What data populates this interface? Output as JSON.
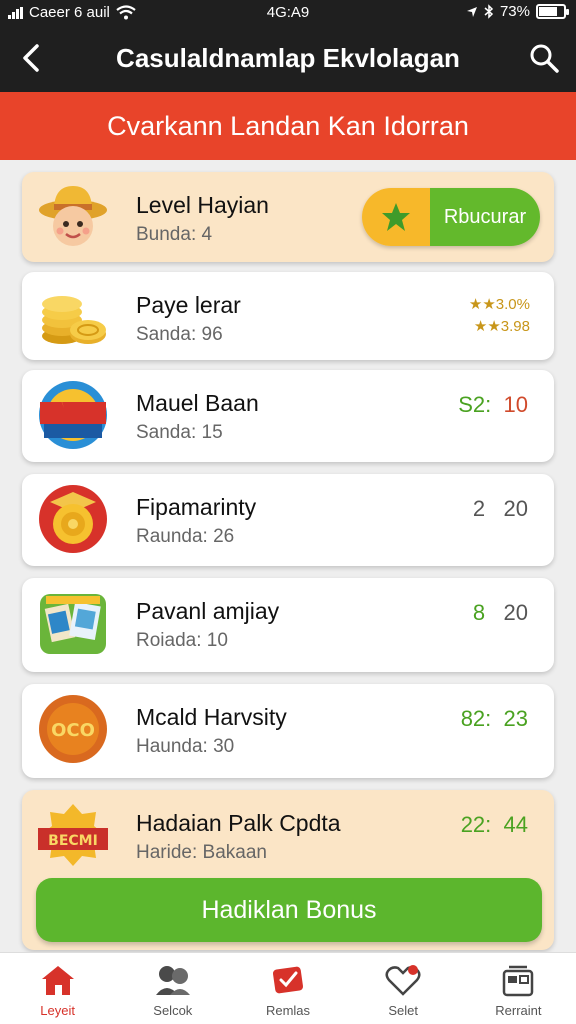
{
  "status_bar": {
    "carrier": "Caeer 6 auil",
    "time": "4G:A9",
    "battery": "73%",
    "battery_level": 0.73
  },
  "header": {
    "title": "Casulaldnamlap Ekvlolagan",
    "back_icon": "back-arrow-icon",
    "search_icon": "search-icon"
  },
  "banner": {
    "text": "Cvarkann Landan Kan Idorran"
  },
  "levels": [
    {
      "name": "Level Hayian",
      "sub": "Bunda: 4",
      "icon": "cowboy-avatar-icon",
      "button_label": "Rbucurar",
      "button_icon": "star-icon"
    },
    {
      "name": "Paye lerar",
      "sub": "Sanda: 96",
      "icon": "gold-coins-icon",
      "stars": [
        "★★3.0%",
        "★★3.98"
      ]
    },
    {
      "name": "Mauel Baan",
      "sub": "Sanda: 15",
      "icon": "badge-icon",
      "score_left": "S2:",
      "score_right": "10"
    },
    {
      "name": "Fipamarinty",
      "sub": "Raunda: 26",
      "icon": "gold-coin-icon",
      "score_left": "2",
      "score_right": "20"
    },
    {
      "name": "Pavanl amjiay",
      "sub": "Roiada: 10",
      "icon": "cards-icon",
      "score_left": "8",
      "score_right": "20"
    },
    {
      "name": "Mcald Harvsity",
      "sub": "Haunda: 30",
      "icon": "medal-icon",
      "score_left": "82:",
      "score_right": "23"
    },
    {
      "name": "Hadaian Palk Cpdta",
      "sub": "Haride: Bakaan",
      "icon": "bonus-badge-icon",
      "score_left": "22:",
      "score_right": "44"
    }
  ],
  "bonus_button": {
    "label": "Hadiklan Bonus"
  },
  "nav": [
    {
      "label": "Leyeit",
      "icon": "home-icon",
      "active": true
    },
    {
      "label": "Selcok",
      "icon": "users-icon",
      "active": false
    },
    {
      "label": "Remlas",
      "icon": "ticket-icon",
      "active": false
    },
    {
      "label": "Selet",
      "icon": "heart-icon",
      "active": false
    },
    {
      "label": "Rerraint",
      "icon": "gift-icon",
      "active": false
    }
  ],
  "colors": {
    "header_bg": "#1f1f1f",
    "banner": "#e8442a",
    "green": "#5cb62d",
    "highlight_card": "#fbe5c6",
    "active_nav": "#d7322a"
  }
}
